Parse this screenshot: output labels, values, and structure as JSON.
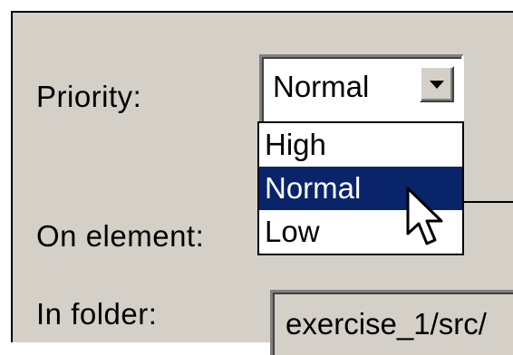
{
  "form": {
    "priority_label": "Priority:",
    "on_element_label": "On element:",
    "in_folder_label": "In folder:"
  },
  "priority_combo": {
    "value": "Normal",
    "options": [
      "High",
      "Normal",
      "Low"
    ],
    "selected_index": 1
  },
  "in_folder": {
    "value": "exercise_1/src/"
  },
  "colors": {
    "dialog_bg": "#d4d0c8",
    "selection_bg": "#0a246a",
    "selection_fg": "#ffffff"
  },
  "icons": {
    "dropdown_arrow": "chevron-down-icon",
    "pointer": "mouse-pointer-icon"
  }
}
